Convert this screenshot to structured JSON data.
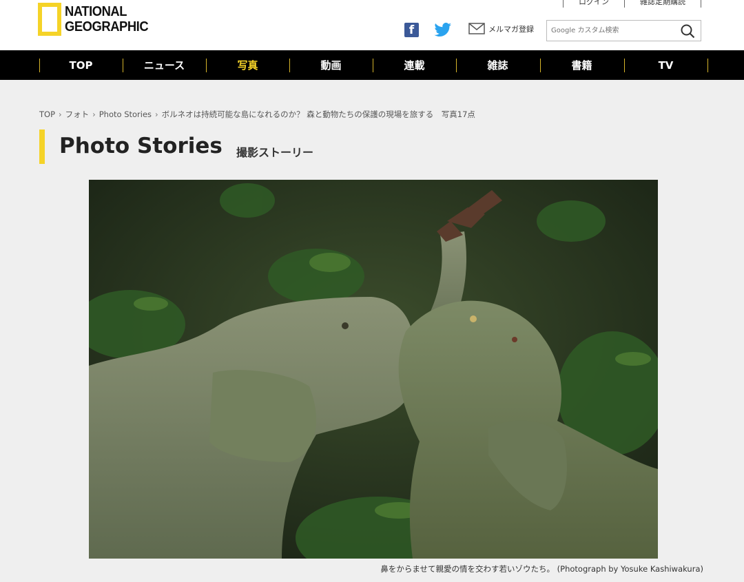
{
  "brand": {
    "line1": "NATIONAL",
    "line2": "GEOGRAPHIC"
  },
  "top_links": [
    "ログイン",
    "雑誌定期購読"
  ],
  "social": {
    "facebook_icon": "facebook-icon",
    "twitter_icon": "twitter-icon",
    "newsletter_label": "メルマガ登録"
  },
  "search": {
    "placeholder": "Google カスタム検索"
  },
  "nav": [
    "TOP",
    "ニュース",
    "写真",
    "動画",
    "連載",
    "雑誌",
    "書籍",
    "TV"
  ],
  "nav_active": "写真",
  "breadcrumb": [
    "TOP",
    "フォト",
    "Photo Stories",
    "ボルネオは持続可能な島になれるのか？ 森と動物たちの保護の現場を旅する　写真17点"
  ],
  "page": {
    "title": "Photo Stories",
    "subtitle": "撮影ストーリー"
  },
  "photo": {
    "caption": "鼻をからませて親愛の情を交わす若いゾウたち。 (Photograph by Yosuke Kashiwakura)"
  },
  "colors": {
    "accent": "#f5d328",
    "nav_bg": "#000000",
    "page_bg": "#efefef"
  }
}
